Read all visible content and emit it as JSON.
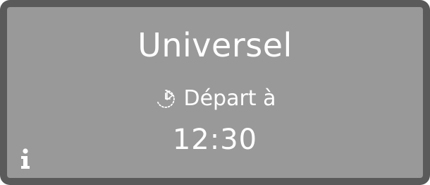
{
  "display": {
    "program_name": "Universel",
    "start_label": "Départ à",
    "start_time": "12:30",
    "icons": {
      "start": "delay-start-timer-icon",
      "info": "info-icon"
    },
    "colors": {
      "bezel": "#5a5a5a",
      "screen": "#999999",
      "text": "#ffffff"
    }
  }
}
